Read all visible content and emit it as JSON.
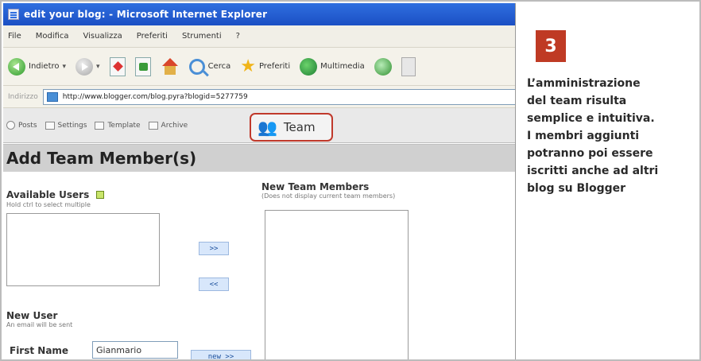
{
  "window": {
    "title": "edit your blog: - Microsoft Internet Explorer"
  },
  "menubar": [
    "File",
    "Modifica",
    "Visualizza",
    "Preferiti",
    "Strumenti",
    "?"
  ],
  "toolbar": {
    "back_label": "Indietro",
    "search_label": "Cerca",
    "favorites_label": "Preferiti",
    "media_label": "Multimedia"
  },
  "address": {
    "label": "Indirizzo",
    "value": "http://www.blogger.com/blog.pyra?blogid=5277759"
  },
  "blog_tabs": [
    {
      "label": "Posts",
      "icon": "posts-icon"
    },
    {
      "label": "Settings",
      "icon": "settings-icon"
    },
    {
      "label": "Template",
      "icon": "template-icon"
    },
    {
      "label": "Archive",
      "icon": "archive-icon"
    }
  ],
  "team_tab": {
    "label": "Team",
    "icon": "team-icon"
  },
  "panel": {
    "title": "Add Team Member(s)"
  },
  "available_users": {
    "title": "Available Users",
    "subtitle": "Hold ctrl to select multiple"
  },
  "new_team_members": {
    "title": "New Team Members",
    "subtitle": "(Does not display current team members)"
  },
  "buttons": {
    "add": ">>",
    "remove": "<<",
    "new_user_add": "new >>"
  },
  "new_user": {
    "title": "New User",
    "subtitle": "An email will be sent",
    "first_name_label": "First Name",
    "first_name_value": "Gianmario"
  },
  "caption": {
    "step_number": "3",
    "lines": [
      "L’amministrazione",
      "del team risulta",
      "semplice e intuitiva.",
      "I membri aggiunti",
      "potranno poi essere",
      "iscritti anche ad altri",
      "blog su Blogger"
    ]
  },
  "colors": {
    "badge": "#bf3a24",
    "highlight_border": "#c0392b",
    "titlebar": "#2f6fe0"
  }
}
